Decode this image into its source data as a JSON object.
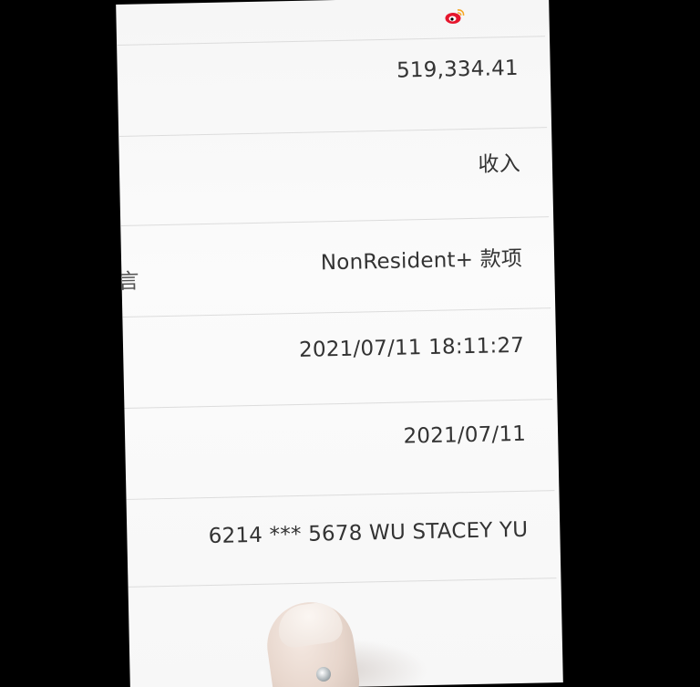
{
  "rows": [
    {
      "value": "519,334.41"
    },
    {
      "value": "收入"
    },
    {
      "value": "NonResident+ 款项",
      "left_partial": "言"
    },
    {
      "value": "2021/07/11 18:11:27"
    },
    {
      "value": "2021/07/11"
    },
    {
      "value": "6214 *** 5678 WU STACEY YU"
    }
  ],
  "watermark": {
    "icon": "weibo-icon"
  },
  "colors": {
    "background": "#000000",
    "screen": "#f8f8f8",
    "text": "#333333",
    "divider": "#dcdcdc"
  }
}
